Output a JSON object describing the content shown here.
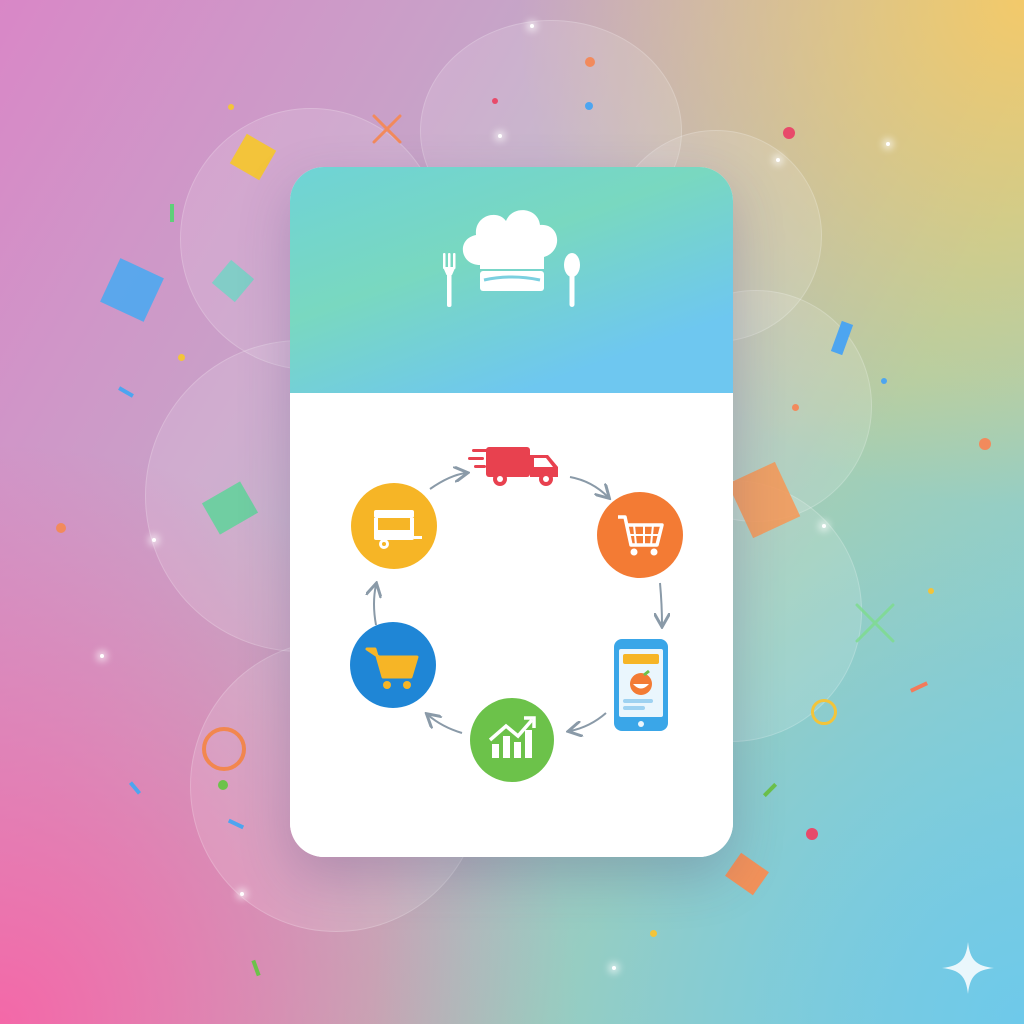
{
  "header": {
    "logo_icon": "chef-hat-fork-spoon-icon",
    "gradient_colors": [
      "#6fd3d6",
      "#79d8c0",
      "#6ec7f0"
    ]
  },
  "cycle": {
    "nodes": [
      {
        "icon": "delivery-truck-icon",
        "color": "#e8414f"
      },
      {
        "icon": "shopping-cart-icon",
        "color": "#f37b34"
      },
      {
        "icon": "mobile-ordering-app-icon",
        "color": "#3aa6e8"
      },
      {
        "icon": "growth-chart-icon",
        "color": "#6cc24a"
      },
      {
        "icon": "shopping-cart-icon",
        "color": "#1f86d6"
      },
      {
        "icon": "food-truck-icon",
        "color": "#f6b526"
      }
    ],
    "arrow_color": "#8a9aa8"
  }
}
